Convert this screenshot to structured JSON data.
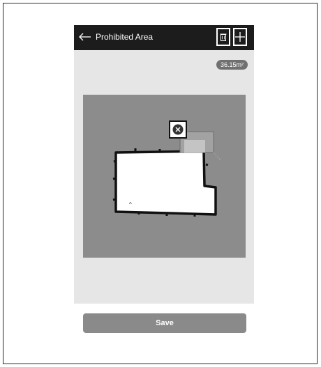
{
  "app": {
    "title": "Prohibited Area"
  },
  "header": {
    "back_icon": "arrow-left-icon",
    "delete_icon": "trash-icon",
    "add_icon": "plus-icon"
  },
  "map": {
    "area_label": "36.15m²",
    "remove_zone_icon": "close-circle-icon",
    "room_marker": "^"
  },
  "footer": {
    "save_label": "Save"
  },
  "colors": {
    "topbar": "#1c1c1c",
    "panel": "#e6e6e6",
    "map_bg": "#8c8c8c",
    "button": "#8a8a8a"
  }
}
